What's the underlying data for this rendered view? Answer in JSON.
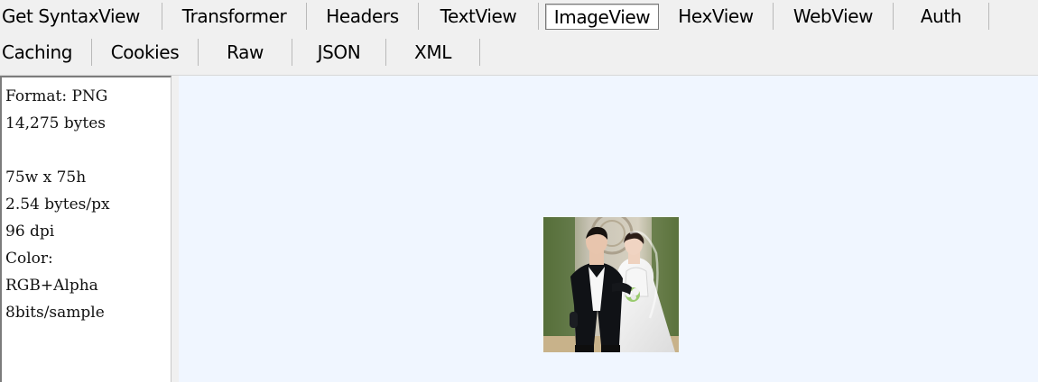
{
  "tabs": {
    "row1": [
      {
        "label": "Get SyntaxView"
      },
      {
        "label": "Transformer"
      },
      {
        "label": "Headers"
      },
      {
        "label": "TextView"
      },
      {
        "label": "ImageView",
        "active": true
      },
      {
        "label": "HexView"
      },
      {
        "label": "WebView"
      },
      {
        "label": "Auth"
      }
    ],
    "row2": [
      {
        "label": "Caching"
      },
      {
        "label": "Cookies"
      },
      {
        "label": "Raw"
      },
      {
        "label": "JSON"
      },
      {
        "label": "XML"
      }
    ]
  },
  "image_info": {
    "lines": [
      "Format: PNG",
      "14,275 bytes",
      "",
      "75w x 75h",
      "2.54 bytes/px",
      "96 dpi",
      "Color:",
      "RGB+Alpha",
      "8bits/sample"
    ]
  },
  "preview": {
    "image_name": "wedding-couple-photo"
  }
}
